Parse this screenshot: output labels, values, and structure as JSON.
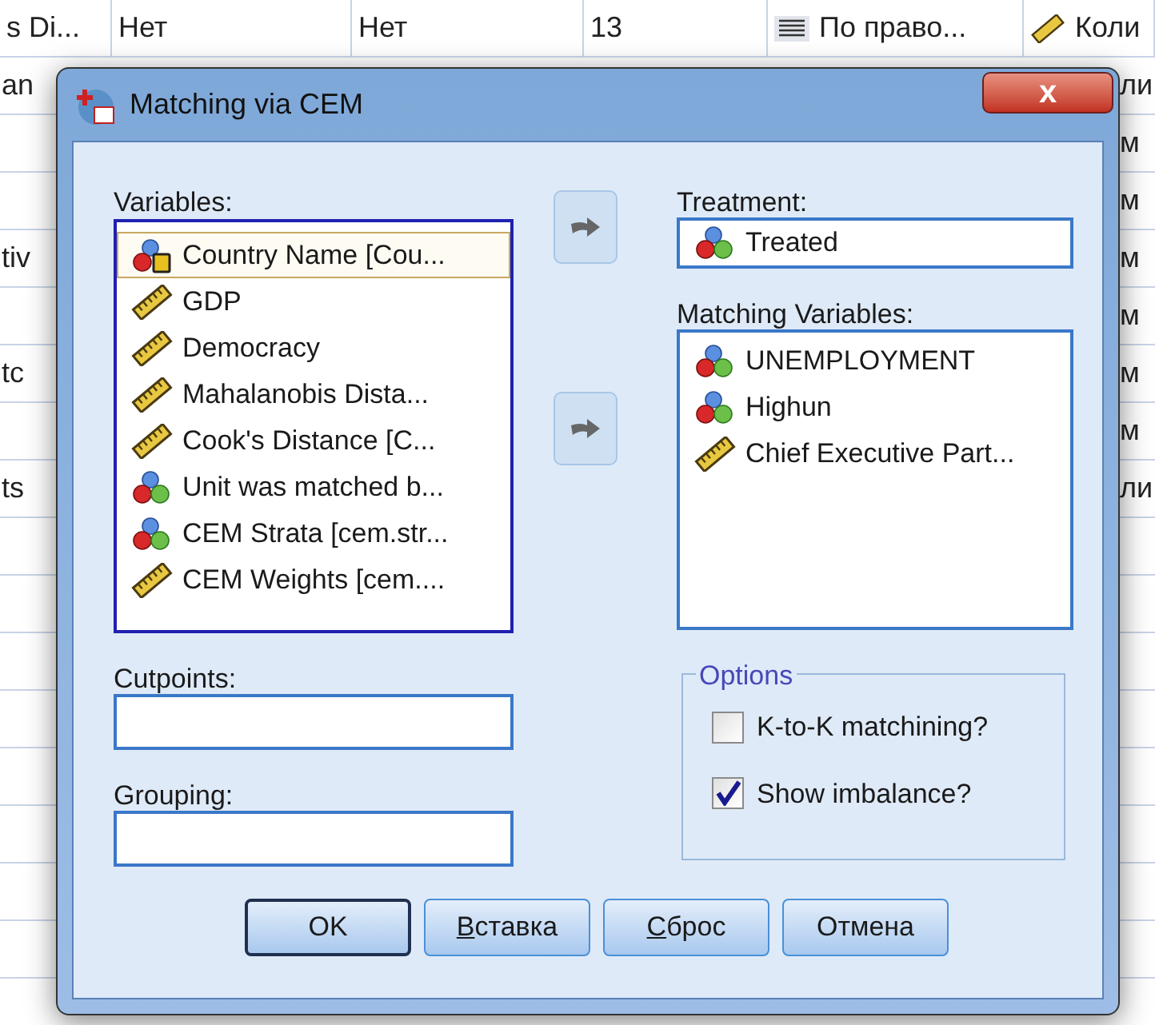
{
  "sheet": {
    "header_cells": [
      "s Di...",
      "Нет",
      "Нет",
      "13",
      "По право...",
      "Коли"
    ],
    "rows": [
      {
        "left": "an",
        "right": "ли"
      },
      {
        "right": "м"
      },
      {
        "right": "м"
      },
      {
        "left": "tiv",
        "right": "м"
      },
      {
        "right": "м"
      },
      {
        "left": "tc",
        "right": "м"
      },
      {
        "right": "м"
      },
      {
        "left": "ts",
        "right": "ли"
      }
    ]
  },
  "window": {
    "title": "Matching via CEM",
    "close": "x"
  },
  "variables": {
    "label": "Variables:",
    "items": [
      {
        "name": "Country Name [Cou...",
        "kind": "string",
        "selected": true
      },
      {
        "name": "GDP",
        "kind": "scale",
        "selected": false
      },
      {
        "name": "Democracy",
        "kind": "scale",
        "selected": false
      },
      {
        "name": "Mahalanobis Dista...",
        "kind": "scale",
        "selected": false
      },
      {
        "name": "Cook's Distance [C...",
        "kind": "scale",
        "selected": false
      },
      {
        "name": "Unit was matched b...",
        "kind": "nominal",
        "selected": false
      },
      {
        "name": "CEM Strata [cem.str...",
        "kind": "nominal",
        "selected": false
      },
      {
        "name": "CEM Weights [cem....",
        "kind": "scale",
        "selected": false
      }
    ]
  },
  "treatment": {
    "label": "Treatment:",
    "item": {
      "name": "Treated",
      "kind": "nominal"
    }
  },
  "matching": {
    "label": "Matching Variables:",
    "items": [
      {
        "name": "UNEMPLOYMENT",
        "kind": "nominal"
      },
      {
        "name": "Highun",
        "kind": "nominal"
      },
      {
        "name": "Chief Executive Part...",
        "kind": "scale"
      }
    ]
  },
  "cutpoints": {
    "label": "Cutpoints:"
  },
  "grouping": {
    "label": "Grouping:"
  },
  "options": {
    "title": "Options",
    "items": [
      {
        "label": "K-to-K matchining?",
        "checked": false
      },
      {
        "label": "Show imbalance?",
        "checked": true
      }
    ]
  },
  "buttons": [
    {
      "label": "OK",
      "default": true,
      "mnemonic": false
    },
    {
      "label": "Вставка",
      "default": false,
      "mnemonic": true
    },
    {
      "label": "Сброс",
      "default": false,
      "mnemonic": true
    },
    {
      "label": "Отмена",
      "default": false,
      "mnemonic": false
    }
  ]
}
